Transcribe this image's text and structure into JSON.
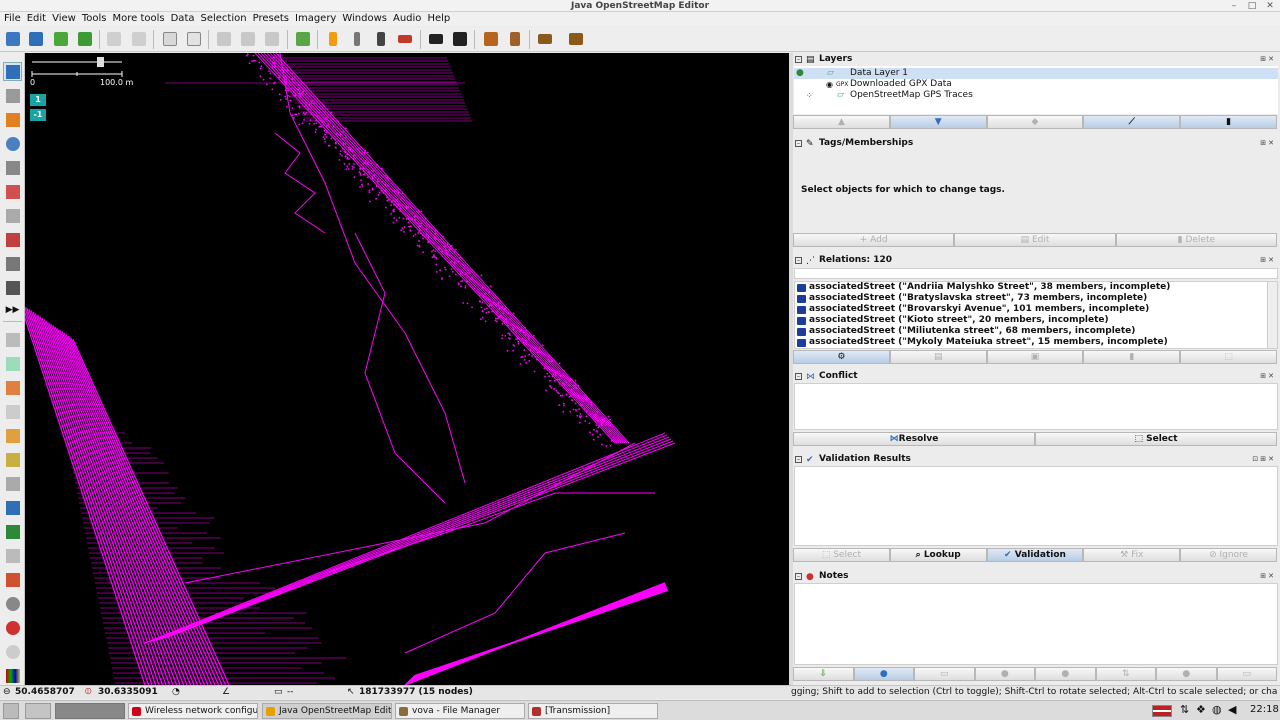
{
  "window": {
    "title": "Java OpenStreetMap Editor",
    "controls": [
      "–",
      "□",
      "✕"
    ]
  },
  "menu": [
    "File",
    "Edit",
    "View",
    "Tools",
    "More tools",
    "Data",
    "Selection",
    "Presets",
    "Imagery",
    "Windows",
    "Audio",
    "Help"
  ],
  "toolbar": {
    "icons": [
      "open-file",
      "save",
      "upload",
      "download",
      "upload-changes",
      "undo",
      "redo",
      "preferences",
      "jump-to",
      "simplify",
      "merge",
      "refresh",
      "wireframe",
      "presets-orange",
      "street-lamp",
      "traffic-signal",
      "barrier",
      "car",
      "bus",
      "warning",
      "restaurant",
      "factory-ruins",
      "industrial-chart"
    ],
    "colors": {
      "accent": "#2f6fb7",
      "orange": "#f39c12",
      "green": "#4aa83b",
      "red": "#c0392b"
    }
  },
  "map": {
    "scale_zero": "0",
    "scale_length": "100.0 m",
    "zoom_badges": [
      "1",
      "-1"
    ],
    "track_color": "#ff00ff",
    "background": "#000000"
  },
  "layers": {
    "title": "Layers",
    "items": [
      {
        "name": "Data Layer 1",
        "active": true
      },
      {
        "name": "Downloaded GPX Data",
        "active": false
      },
      {
        "name": "OpenStreetMap GPS Traces",
        "active": false
      }
    ],
    "buttons": [
      "move-up-icon",
      "move-down-icon",
      "merge-icon",
      "visibility-icon",
      "delete-icon"
    ]
  },
  "tags": {
    "title": "Tags/Memberships",
    "message": "Select objects for which to change tags.",
    "buttons": {
      "add": "Add",
      "edit": "Edit",
      "delete": "Delete"
    }
  },
  "relations": {
    "title": "Relations: 120",
    "items": [
      "associatedStreet (\"Andriia Malyshko Street\", 38 members, incomplete)",
      "associatedStreet (\"Bratyslavska street\", 73 members, incomplete)",
      "associatedStreet (\"Brovarskyi Avenue\", 101 members, incomplete)",
      "associatedStreet (\"Kioto street\", 20 members, incomplete)",
      "associatedStreet (\"Miliutenka street\", 68 members, incomplete)",
      "associatedStreet (\"Mykoly Mateiuka street\", 15 members, incomplete)"
    ]
  },
  "conflict": {
    "title": "Conflict",
    "buttons": {
      "resolve": "Resolve",
      "select": "Select"
    }
  },
  "validation": {
    "title": "Validation Results",
    "buttons": {
      "select": "Select",
      "lookup": "Lookup",
      "validation": "Validation",
      "fix": "Fix",
      "ignore": "Ignore"
    }
  },
  "notes": {
    "title": "Notes"
  },
  "status": {
    "lat": "50.4658707",
    "lon": "30.6335091",
    "length": "--",
    "selection": "181733977 (15 nodes)",
    "help": "gging; Shift to add to selection (Ctrl to toggle); Shift-Ctrl to rotate selected; Alt-Ctrl to scale selected; or change selection"
  },
  "taskbar": {
    "tasks": [
      {
        "label": "Wireless network configur...",
        "color": "#d0021b",
        "current": false
      },
      {
        "label": "Java OpenStreetMap Editor",
        "color": "#e8a000",
        "current": true
      },
      {
        "label": "vova - File Manager",
        "color": "#8a6d3b",
        "current": false
      },
      {
        "label": "[Transmission]",
        "color": "#b03030",
        "current": false
      }
    ],
    "clock": "22:18"
  }
}
